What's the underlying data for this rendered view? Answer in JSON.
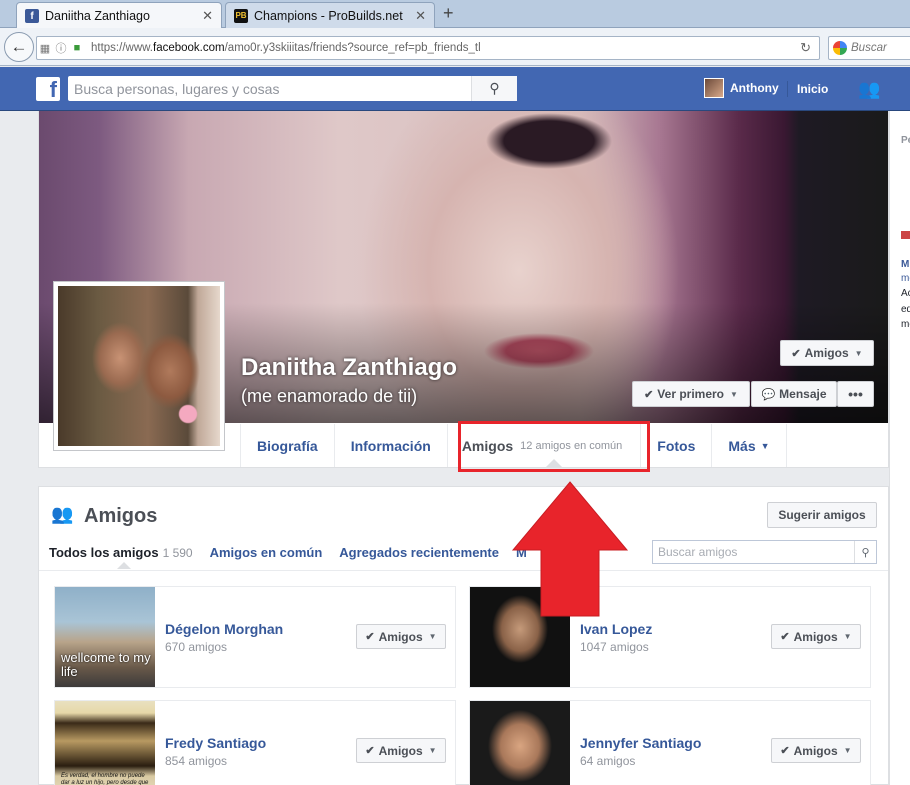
{
  "browser": {
    "tabs": [
      {
        "title": "Daniitha Zanthiago",
        "favicon": "facebook-icon"
      },
      {
        "title": "Champions - ProBuilds.net",
        "favicon": "PB"
      }
    ],
    "url_prefix": "https://www.",
    "url_domain": "facebook.com",
    "url_path": "/amo0r.y3skiiitas/friends?source_ref=pb_friends_tl",
    "search_placeholder": "Buscar"
  },
  "fb_header": {
    "logo": "f",
    "search_placeholder": "Busca personas, lugares y cosas",
    "user_name": "Anthony",
    "home_label": "Inicio"
  },
  "profile": {
    "name": "Daniitha Zanthiago",
    "subname": "(me enamorado de tii)",
    "friend_button": "Amigos",
    "see_first_button": "Ver primero",
    "message_button": "Mensaje",
    "more_button": "•••",
    "tabs": [
      {
        "label": "Biografía"
      },
      {
        "label": "Información"
      },
      {
        "label": "Amigos",
        "sub": "12 amigos en común"
      },
      {
        "label": "Fotos"
      },
      {
        "label": "Más"
      }
    ]
  },
  "friends_section": {
    "title": "Amigos",
    "suggest_button": "Sugerir amigos",
    "tabs": [
      {
        "label": "Todos los amigos",
        "count": "1 590"
      },
      {
        "label": "Amigos en común"
      },
      {
        "label": "Agregados recientemente"
      },
      {
        "label": "M"
      }
    ],
    "search_placeholder": "Buscar amigos",
    "friends": [
      {
        "name": "Dégelon Morghan",
        "count": "670 amigos",
        "button": "Amigos",
        "thumb_caption": "wellcome to my life"
      },
      {
        "name": "Ivan Lopez",
        "count": "1047 amigos",
        "button": "Amigos"
      },
      {
        "name": "Fredy Santiago",
        "count": "854 amigos",
        "button": "Amigos",
        "thumb_caption": "Es verdad, el hombre no puede dar a luz un hijo, pero desde que lo dicen"
      },
      {
        "name": "Jennyfer Santiago",
        "count": "64 amigos",
        "button": "Amigos"
      }
    ]
  },
  "right_column": {
    "lines": [
      "Pe",
      "M",
      "me",
      "Ac",
      "ed",
      "me"
    ]
  },
  "colors": {
    "fb_blue": "#4267b2",
    "link": "#365899",
    "annotation_red": "#e8242b"
  }
}
